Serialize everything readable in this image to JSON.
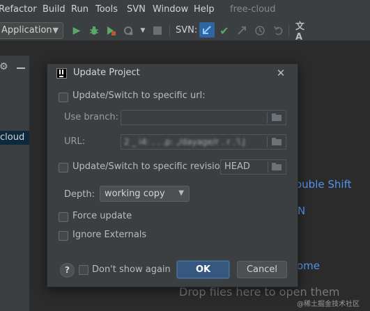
{
  "menubar": {
    "items": [
      "Refactor",
      "Build",
      "Run",
      "Tools",
      "SVN",
      "Window",
      "Help"
    ],
    "project_title": "free-cloud"
  },
  "toolbar": {
    "run_config": "Application",
    "svn_label": "SVN:",
    "icons": [
      "run-icon",
      "debug-icon",
      "coverage-icon",
      "more-run-icon",
      "stop-icon",
      "svn-update-icon",
      "svn-commit-icon",
      "svn-compare-icon",
      "svn-history-icon",
      "svn-revert-icon",
      "translate-icon"
    ]
  },
  "left_panel": {
    "item_label": "cloud"
  },
  "background": {
    "shortcut_fragment": "ouble Shift",
    "nav_fragment": "N",
    "home_fragment": "ome",
    "drop_text": "Drop files here to open them",
    "watermark": "@稀土掘金技术社区"
  },
  "dialog": {
    "title": "Update Project",
    "close_glyph": "✕",
    "specific_url_label": "Update/Switch to specific url:",
    "specific_url_checked": false,
    "branch_label": "Use branch:",
    "branch_value": "",
    "url_label": "URL:",
    "url_value": "2 _ i4: . .  .p: ,/dayage/r  . r  .'l.J",
    "specific_revision_label": "Update/Switch to specific revision:",
    "specific_revision_checked": false,
    "revision_value": "HEAD",
    "depth_label": "Depth:",
    "depth_value": "working copy",
    "force_update_label": "Force update",
    "force_update_checked": false,
    "ignore_externals_label": "Ignore Externals",
    "ignore_externals_checked": false,
    "help_glyph": "?",
    "dont_show_label": "Don't show again",
    "dont_show_checked": false,
    "ok_label": "OK",
    "cancel_label": "Cancel"
  },
  "colors": {
    "accent_blue": "#5394ec",
    "ok_button": "#365880",
    "dialog_bg": "#3c3f41",
    "editor_bg": "#2b2b2b"
  }
}
